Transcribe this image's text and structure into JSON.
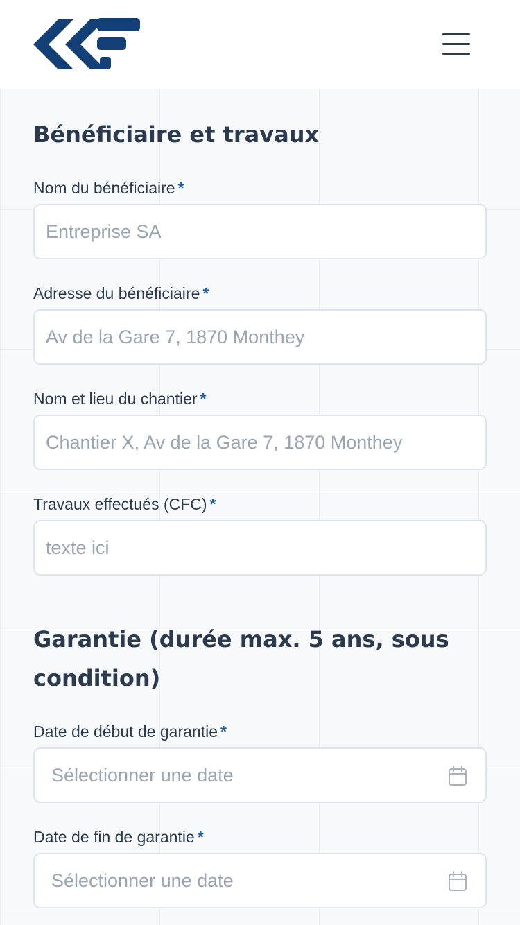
{
  "header": {
    "logo_icon": "ccf-logo-icon",
    "menu_icon": "hamburger-menu-icon"
  },
  "colors": {
    "brand": "#123f75",
    "text": "#2c3a4f",
    "required_mark": "#1f5fa8",
    "placeholder": "#9aa5b3",
    "input_border": "#dfe5ee",
    "background": "#f7f9fb"
  },
  "sections": [
    {
      "title": "Bénéficiaire et travaux",
      "fields": [
        {
          "label": "Nom du bénéficiaire",
          "required": "*",
          "placeholder": "Entreprise SA",
          "value": ""
        },
        {
          "label": "Adresse du bénéficiaire",
          "required": "*",
          "placeholder": "Av de la Gare 7, 1870 Monthey",
          "value": ""
        },
        {
          "label": "Nom et lieu du chantier",
          "required": "*",
          "placeholder": "Chantier X, Av de la Gare 7, 1870 Monthey",
          "value": ""
        },
        {
          "label": "Travaux effectués (CFC)",
          "required": "*",
          "placeholder": "texte ici",
          "value": ""
        }
      ]
    },
    {
      "title_line1": "Garantie (durée max. 5 ans, sous",
      "title_line2": "condition)",
      "fields": [
        {
          "label": "Date de début de garantie",
          "required": "*",
          "placeholder": "Sélectionner une date",
          "icon": "calendar-icon"
        },
        {
          "label": "Date de fin de garantie",
          "required": "*",
          "placeholder": "Sélectionner une date",
          "icon": "calendar-icon"
        }
      ]
    }
  ]
}
